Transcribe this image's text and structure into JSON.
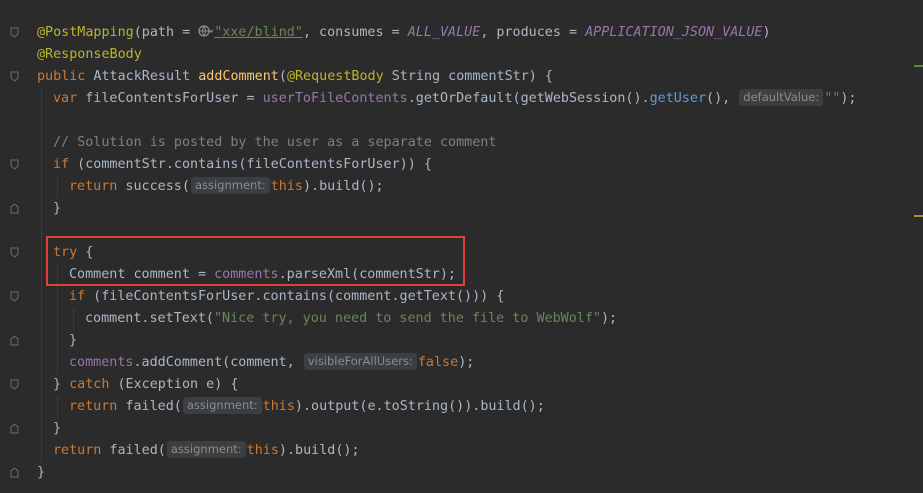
{
  "code": {
    "l1": {
      "ann": "@PostMapping",
      "a": "(path = ",
      "path": "\"xxe/blind\"",
      "b": ", consumes = ",
      "consumes": "ALL_VALUE",
      "c": ", produces = ",
      "produces": "APPLICATION_JSON_VALUE",
      "d": ")"
    },
    "l2": {
      "ann": "@ResponseBody"
    },
    "l3": {
      "kw": "public",
      "a": " AttackResult ",
      "fn": "addComment",
      "b": "(",
      "ann": "@RequestBody",
      "c": " String commentStr) {"
    },
    "l4": {
      "kw": "var",
      "a": " fileContentsForUser = ",
      "field": "userToFileContents",
      "b": ".getOrDefault(getWebSession().",
      "call": "getUser",
      "c": "(), ",
      "hint": "defaultValue:",
      "str": "\"\"",
      "d": ");"
    },
    "l6": {
      "comment": "// Solution is posted by the user as a separate comment"
    },
    "l7": {
      "kw": "if",
      "a": " (commentStr.contains(fileContentsForUser)) {"
    },
    "l8": {
      "kw": "return",
      "a": " success(",
      "hint": "assignment:",
      "this": "this",
      "b": ").build();"
    },
    "l9": {
      "a": "}"
    },
    "l11": {
      "kw": "try",
      "a": " {"
    },
    "l12": {
      "a": "Comment comment = ",
      "field": "comments",
      "b": ".parseXml(commentStr);"
    },
    "l13": {
      "kw": "if",
      "a": " (fileContentsForUser.contains(comment.getText())) {"
    },
    "l14": {
      "a": "comment.setText(",
      "str": "\"Nice try, you need to send the file to WebWolf\"",
      "b": ");"
    },
    "l15": {
      "a": "}"
    },
    "l16": {
      "field": "comments",
      "a": ".addComment(comment, ",
      "hint": "visibleForAllUsers:",
      "kw": "false",
      "b": ");"
    },
    "l17": {
      "a": "} ",
      "kw": "catch",
      "b": " (Exception e) {"
    },
    "l18": {
      "kw": "return",
      "a": " failed(",
      "hint": "assignment:",
      "this": "this",
      "b": ").output(e.toString()).build();"
    },
    "l19": {
      "a": "}"
    },
    "l20": {
      "kw": "return",
      "a": " failed(",
      "hint": "assignment:",
      "this": "this",
      "b": ").build();"
    },
    "l21": {
      "a": "}"
    }
  },
  "colors": {
    "background": "#2b2b2b",
    "keyword": "#cc7832",
    "annotation": "#bbb529",
    "string": "#6a8759",
    "field": "#9876aa",
    "method": "#ffc66d",
    "comment": "#808080",
    "highlight_box": "#e0403a"
  },
  "icons": {
    "fold": "fold-marker-icon",
    "globe": "url-globe-icon"
  }
}
